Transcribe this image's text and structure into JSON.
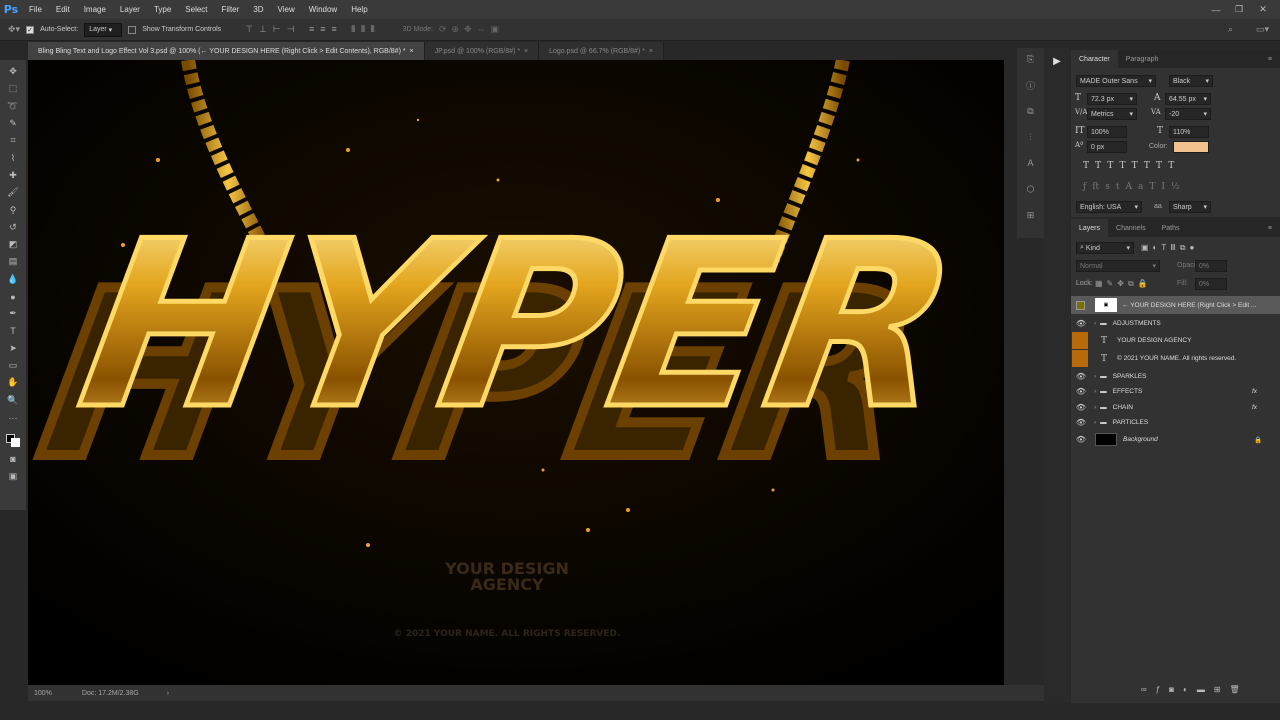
{
  "app": {
    "logo": "Ps"
  },
  "menu": [
    "File",
    "Edit",
    "Image",
    "Layer",
    "Type",
    "Select",
    "Filter",
    "3D",
    "View",
    "Window",
    "Help"
  ],
  "options": {
    "auto_select": "Auto-Select:",
    "target": "Layer",
    "transform": "Show Transform Controls",
    "mode3d": "3D Mode:"
  },
  "tabs": [
    {
      "label": "Bling Bling Text and Logo Effect Vol 3.psd @ 100% (← YOUR DESIGN HERE (Right Click > Edit Contents), RGB/8#) *"
    },
    {
      "label": "JP.psd @ 100% (RGB/8#) *"
    },
    {
      "label": "Logo.psd @ 66.7% (RGB/8#) *"
    }
  ],
  "canvas": {
    "headline": "HYPER",
    "agency_line1": "YOUR DESIGN",
    "agency_line2": "AGENCY",
    "copyright": "© 2021 YOUR NAME. ALL RIGHTS RESERVED."
  },
  "status": {
    "zoom": "100%",
    "doc": "Doc: 17.2M/2.38G",
    "arrow": "›"
  },
  "character": {
    "tab_character": "Character",
    "tab_paragraph": "Paragraph",
    "font": "MADE Outer Sans",
    "style": "Black",
    "size": "72.3 px",
    "leading": "64.55 px",
    "kerning": "Metrics",
    "tracking": "-20",
    "vscale": "100%",
    "hscale": "110%",
    "baseline": "0 px",
    "color_label": "Color:",
    "color": "#efc28e",
    "language": "English: USA",
    "aa_label": "aa",
    "antialias": "Sharp"
  },
  "layers": {
    "tab_layers": "Layers",
    "tab_channels": "Channels",
    "tab_paths": "Paths",
    "filter": "Kind",
    "blend": "Normal",
    "opacity_label": "Opacity:",
    "opacity": "0%",
    "lock_label": "Lock:",
    "fill_label": "Fill:",
    "fill": "0%",
    "items": [
      {
        "name": "← YOUR DESIGN HERE (Right Click > Edit ...",
        "type": "smart"
      },
      {
        "name": "ADJUSTMENTS",
        "type": "group"
      },
      {
        "name": "YOUR DESIGN AGENCY",
        "type": "text"
      },
      {
        "name": "© 2021 YOUR NAME. All rights reserved.",
        "type": "text"
      },
      {
        "name": "SPARKLES",
        "type": "group"
      },
      {
        "name": "EFFECTS",
        "type": "group",
        "fx": "fx"
      },
      {
        "name": "CHAIN",
        "type": "group",
        "fx": "fx"
      },
      {
        "name": "PARTICLES",
        "type": "group"
      },
      {
        "name": "Background",
        "type": "bg"
      }
    ]
  }
}
